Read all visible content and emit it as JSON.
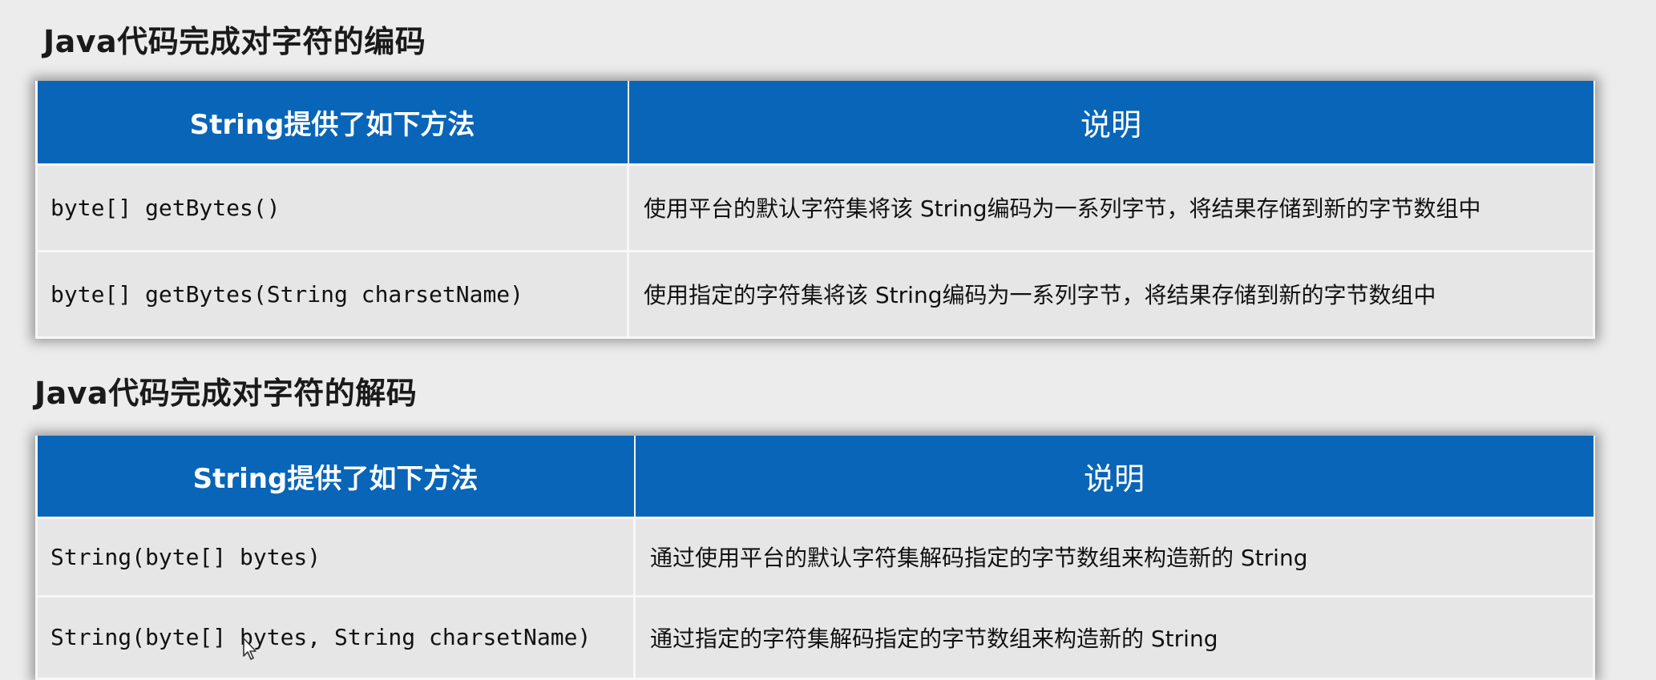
{
  "encode_section": {
    "title": "Java代码完成对字符的编码",
    "header_method": "String提供了如下方法",
    "header_desc": "说明",
    "rows": [
      {
        "method": "byte[] getBytes()",
        "desc": "使用平台的默认字符集将该 String编码为一系列字节，将结果存储到新的字节数组中"
      },
      {
        "method": "byte[] getBytes(String charsetName)",
        "desc": "使用指定的字符集将该 String编码为一系列字节，将结果存储到新的字节数组中"
      }
    ]
  },
  "decode_section": {
    "title": "Java代码完成对字符的解码",
    "header_method": "String提供了如下方法",
    "header_desc": "说明",
    "rows": [
      {
        "method": "String(byte[] bytes)",
        "desc": "通过使用平台的默认字符集解码指定的字节数组来构造新的 String"
      },
      {
        "method": "String(byte[] bytes, String charsetName)",
        "desc": "通过指定的字符集解码指定的字节数组来构造新的 String"
      }
    ]
  },
  "colors": {
    "header_bg": "#0865b8",
    "header_text": "#ffffff",
    "cell_bg": "#e6e6e6",
    "page_bg": "#ececec"
  },
  "icons": {
    "cursor": "mouse-pointer-icon"
  }
}
